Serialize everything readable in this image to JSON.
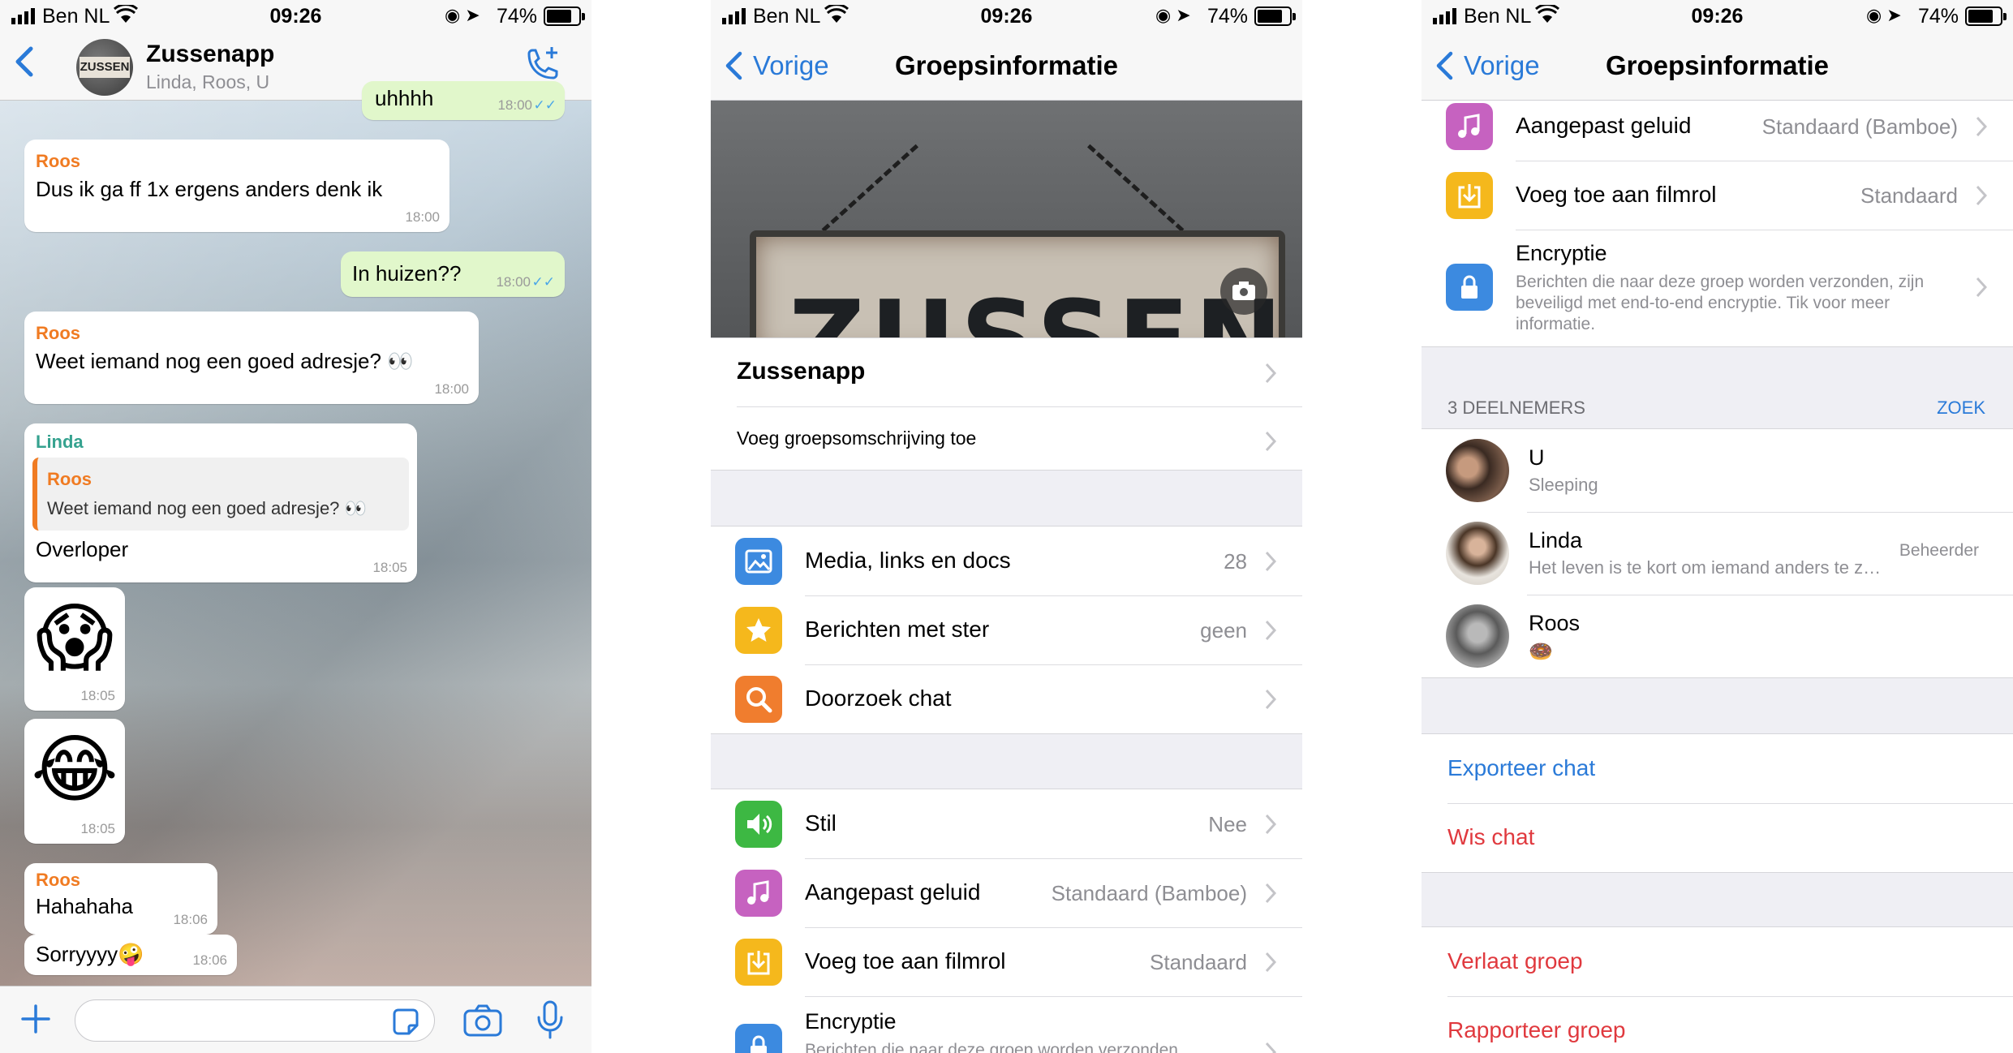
{
  "status": {
    "carrier": "Ben NL",
    "time": "09:26",
    "battery": "74%",
    "battery_level": 0.74
  },
  "chat": {
    "name": "Zussenapp",
    "members": "Linda, Roos, U",
    "avatar_text": "ZUSSEN",
    "partial_text": "uhhhh",
    "partial_time": "18:00",
    "messages": [
      {
        "sender": "Roos",
        "text": "Dus ik ga ff 1x ergens anders denk ik",
        "time": "18:00"
      },
      {
        "text": "In huizen??",
        "time": "18:00"
      },
      {
        "sender": "Roos",
        "text": "Weet iemand nog een goed adresje? 👀",
        "time": "18:00"
      },
      {
        "sender": "Linda",
        "quote_sender": "Roos",
        "quote_text": "Weet iemand nog een goed adresje? 👀",
        "text": "Overloper",
        "time": "18:05"
      },
      {
        "text": "😱",
        "time": "18:05"
      },
      {
        "text": "😂",
        "time": "18:05"
      },
      {
        "sender": "Roos",
        "text": "Hahahaha",
        "time": "18:06"
      },
      {
        "text": "Sorryyyy🤪",
        "time": "18:06"
      }
    ],
    "ticks": "✓✓"
  },
  "info": {
    "back": "Vorige",
    "title": "Groepsinformatie",
    "hero_text": "ZUSSEN",
    "group_name": "Zussenapp",
    "add_description": "Voeg groepsomschrijving toe",
    "media": {
      "label": "Media, links en docs",
      "value": "28"
    },
    "starred": {
      "label": "Berichten met ster",
      "value": "geen"
    },
    "search": {
      "label": "Doorzoek chat"
    },
    "mute": {
      "label": "Stil",
      "value": "Nee"
    },
    "sound": {
      "label": "Aangepast geluid",
      "value": "Standaard (Bamboe)"
    },
    "save": {
      "label": "Voeg toe aan filmrol",
      "value": "Standaard"
    },
    "encryption": {
      "label": "Encryptie",
      "desc": "Berichten die naar deze groep worden verzonden, zijn beveiligd met end-to-end encryptie. Tik voor meer informatie.",
      "desc_partial": "Berichten die naar deze groep worden verzonden"
    },
    "participants_header": "3 DEELNEMERS",
    "search_link": "ZOEK",
    "participants": [
      {
        "name": "U",
        "status": "Sleeping",
        "role": ""
      },
      {
        "name": "Linda",
        "status": "Het leven is te kort om iemand anders te z…",
        "role": "Beheerder"
      },
      {
        "name": "Roos",
        "status": "🍩",
        "role": ""
      }
    ],
    "export": "Exporteer chat",
    "clear": "Wis chat",
    "leave": "Verlaat groep",
    "report": "Rapporteer groep"
  },
  "colors": {
    "ios_blue": "#2a7ad8",
    "destructive_red": "#e0393e",
    "sender_orange": "#f07b22",
    "sender_teal": "#35a28f",
    "outgoing_bubble": "#e1f7cb",
    "icon_media": "#3c8ae0",
    "icon_star": "#f5b81c",
    "icon_search": "#f07d2e",
    "icon_mute": "#3db843",
    "icon_sound": "#c662c0",
    "icon_save": "#f5b81c",
    "icon_lock": "#3c8ae0"
  }
}
